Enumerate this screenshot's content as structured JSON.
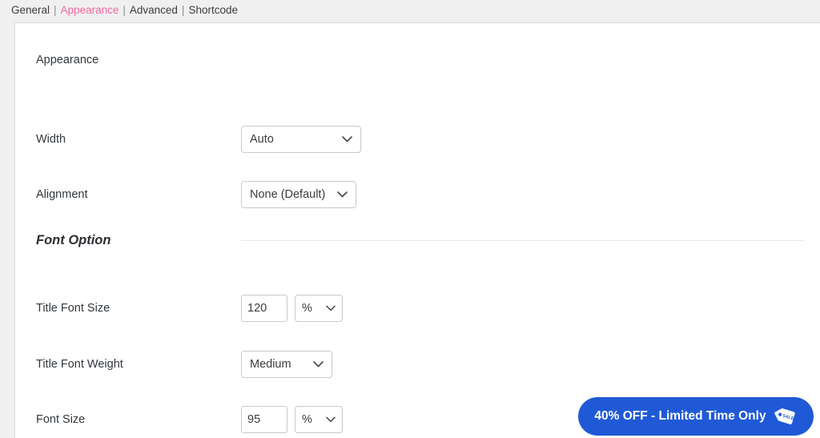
{
  "topbar": {
    "tabs": [
      {
        "label": "General",
        "active": false
      },
      {
        "label": "Appearance",
        "active": true
      },
      {
        "label": "Advanced",
        "active": false
      },
      {
        "label": "Shortcode",
        "active": false
      }
    ],
    "separator": "|",
    "active_color": "#f2699c",
    "inactive_color": "#3c3c3c"
  },
  "panel": {
    "section_title": "Appearance",
    "rows": [
      {
        "label": "Width",
        "control": "select",
        "value": "Auto",
        "icon": "chevron-down-icon"
      },
      {
        "label": "Alignment",
        "control": "select",
        "value": "None (Default)",
        "icon": "chevron-down-icon"
      }
    ],
    "subsection": {
      "title": "Font Option",
      "divider": true
    },
    "font_rows": [
      {
        "label": "Title Font Size",
        "control": "number-with-unit",
        "value": "120",
        "unit": "%",
        "icon": "chevron-down-icon"
      },
      {
        "label": "Title Font Weight",
        "control": "select",
        "value": "Medium",
        "icon": "chevron-down-icon"
      },
      {
        "label": "Font Size",
        "control": "number-with-unit",
        "value": "95",
        "unit": "%",
        "icon": "chevron-down-icon"
      }
    ]
  },
  "promo": {
    "text": "40% OFF - Limited Time Only",
    "icon": "sale-tag-icon",
    "icon_label": "SALE",
    "background_color": "#2059d6",
    "text_color": "#ffffff"
  }
}
